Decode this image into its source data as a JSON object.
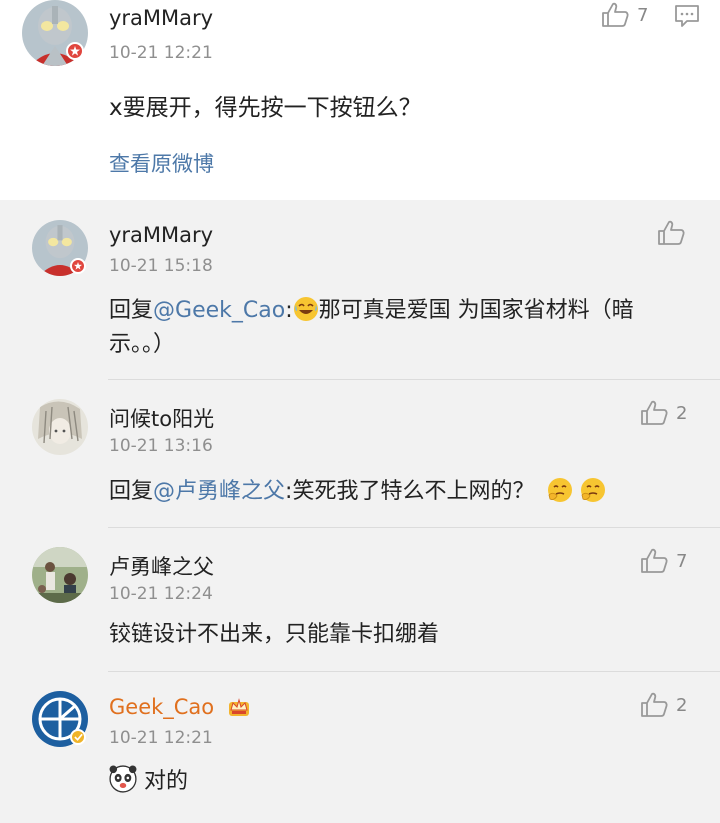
{
  "main_post": {
    "username": "yraMMary",
    "time": "10-21 12:21",
    "text": "x要展开，得先按一下按钮么？",
    "view_original": "查看原微博",
    "like_count": "7"
  },
  "replies": [
    {
      "username": "yraMMary",
      "time": "10-21 15:18",
      "reply_prefix": "回复",
      "mention": "@Geek_Cao",
      "colon": ":",
      "text_line1": "那可真是爱国 为国家省材料（暗",
      "text_line2": "示。。）",
      "like_count": ""
    },
    {
      "username": "问候to阳光",
      "time": "10-21 13:16",
      "reply_prefix": "回复",
      "mention": "@卢勇峰之父",
      "colon": ":",
      "text": "笑死我了特么不上网的？",
      "like_count": "2"
    },
    {
      "username": "卢勇峰之父",
      "time": "10-21 12:24",
      "text": "铰链设计不出来，只能靠卡扣绷着",
      "like_count": "7"
    },
    {
      "username": "Geek_Cao",
      "time": "10-21 12:21",
      "text": "对的",
      "like_count": "2"
    }
  ],
  "colors": {
    "link": "#4d78a8",
    "vip_name": "#e0701e",
    "background": "#f2f2f2"
  }
}
